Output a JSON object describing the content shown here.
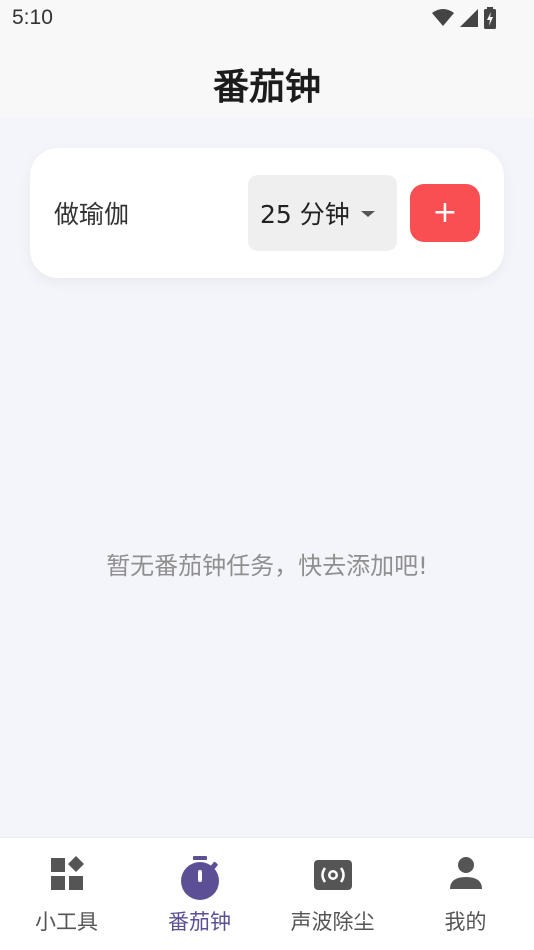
{
  "status_bar": {
    "time": "5:10",
    "icons": [
      "wifi-icon",
      "signal-icon",
      "battery-icon"
    ]
  },
  "header": {
    "title": "番茄钟"
  },
  "add_card": {
    "task_value": "做瑜伽",
    "duration_label": "25 分钟",
    "add_button_label": "+"
  },
  "empty_state": {
    "message": "暂无番茄钟任务，快去添加吧!"
  },
  "bottom_nav": {
    "items": [
      {
        "label": "小工具",
        "icon": "widgets-icon",
        "active": false
      },
      {
        "label": "番茄钟",
        "icon": "timer-icon",
        "active": true
      },
      {
        "label": "声波除尘",
        "icon": "speaker-icon",
        "active": false
      },
      {
        "label": "我的",
        "icon": "person-icon",
        "active": false
      }
    ]
  },
  "colors": {
    "accent": "#f94f52",
    "active_nav": "#5d4f96",
    "background": "#f4f5fa"
  }
}
